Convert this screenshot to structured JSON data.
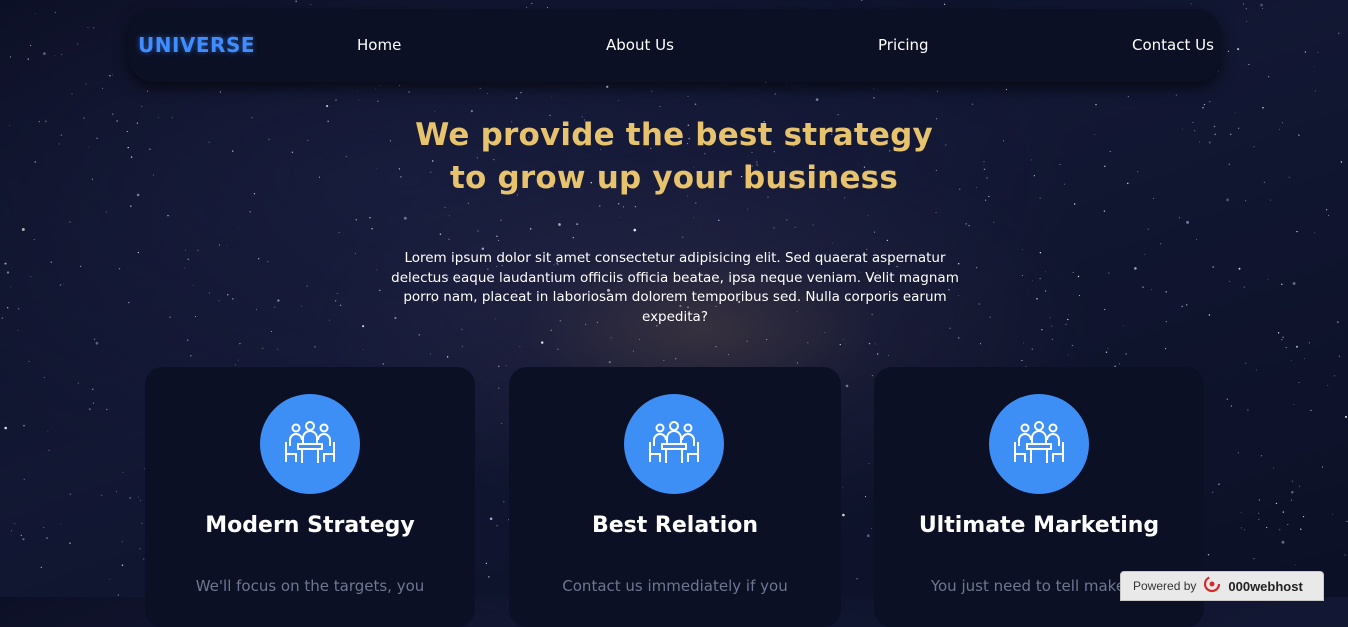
{
  "nav": {
    "logo": "UNIVERSE",
    "links": [
      "Home",
      "About Us",
      "Pricing",
      "Contact Us"
    ]
  },
  "hero": {
    "title_line1": "We provide the best strategy",
    "title_line2": "to grow up your business",
    "text": "Lorem ipsum dolor sit amet consectetur adipisicing elit. Sed quaerat aspernatur delectus eaque laudantium officiis officia beatae, ipsa neque veniam. Velit magnam porro nam, placeat in laboriosam dolorem temporibus sed. Nulla corporis earum expedita?"
  },
  "cards": [
    {
      "icon": "meeting-icon",
      "title": "Modern Strategy",
      "text": "We'll focus on the targets, you"
    },
    {
      "icon": "meeting-icon",
      "title": "Best Relation",
      "text": "Contact us immediately if you"
    },
    {
      "icon": "meeting-icon",
      "title": "Ultimate Marketing",
      "text": "You just need to tell make su"
    }
  ],
  "badge": {
    "label": "Powered by",
    "brand": "000webhost"
  },
  "colors": {
    "accent_blue": "#3d8ef5",
    "title_gold": "#e7c36d",
    "panel": "#0b1024"
  }
}
